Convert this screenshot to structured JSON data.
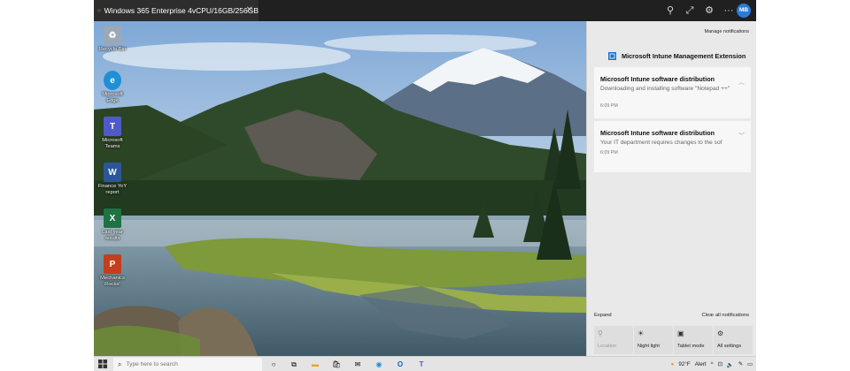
{
  "window": {
    "tab_title": "Windows 365 Enterprise 4vCPU/16GB/256GB",
    "avatar_initials": "MB",
    "icons": [
      "pin-icon",
      "expand-icon",
      "settings-gear-icon",
      "more-icon"
    ]
  },
  "desktop": {
    "icons": [
      {
        "label": "Recycle Bin",
        "icon": "recycle-bin-icon",
        "color": "#9aa8b8"
      },
      {
        "label": "Microsoft Edge",
        "icon": "edge-icon",
        "color": "#1f8fd6"
      },
      {
        "label": "Microsoft Teams",
        "icon": "teams-icon",
        "color": "#5059c9"
      },
      {
        "label": "Finance YoY report",
        "icon": "word-doc-icon",
        "color": "#2b5797"
      },
      {
        "label": "Last year results",
        "icon": "excel-doc-icon",
        "color": "#1f7244"
      },
      {
        "label": "Mechanics Rocks!",
        "icon": "powerpoint-doc-icon",
        "color": "#c43e1c"
      }
    ]
  },
  "action_center": {
    "manage_label": "Manage notifications",
    "group_title": "Microsoft Intune Management Extension",
    "notifications": [
      {
        "title": "Microsoft Intune software distribution",
        "body": "Downloading and installing software \"Notepad ++\"",
        "time": "6:09 PM"
      },
      {
        "title": "Microsoft Intune software distribution",
        "body": "Your IT department requires changes to the sof",
        "time": "6:09 PM"
      }
    ],
    "expand_label": "Expand",
    "clear_label": "Clear all notifications",
    "quick_actions": [
      {
        "label": "Location",
        "icon": "location-icon",
        "enabled": false
      },
      {
        "label": "Night light",
        "icon": "night-light-icon",
        "enabled": true
      },
      {
        "label": "Tablet mode",
        "icon": "tablet-mode-icon",
        "enabled": true
      },
      {
        "label": "All settings",
        "icon": "settings-icon",
        "enabled": true
      }
    ]
  },
  "taskbar": {
    "search_placeholder": "Type here to search",
    "apps": [
      "cortana-icon",
      "task-view-icon",
      "file-explorer-icon",
      "store-icon",
      "mail-icon",
      "edge-icon",
      "outlook-icon",
      "teams-icon"
    ],
    "weather": "92°F",
    "alert": "Alert",
    "tray_icons": [
      "chevron-up-icon",
      "network-icon",
      "volume-icon",
      "pen-icon",
      "notification-icon"
    ]
  },
  "colors": {
    "accent": "#2a7bd4",
    "action_center_bg": "#e9e9e9",
    "taskbar_bg": "#e4e4e4"
  }
}
